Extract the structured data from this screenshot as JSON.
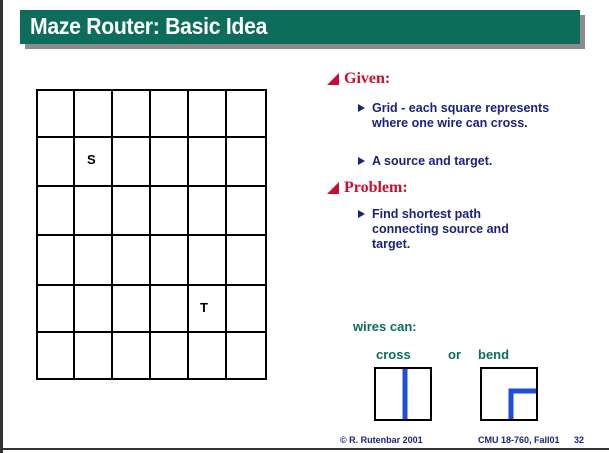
{
  "slide": {
    "title": "Maze Router: Basic Idea"
  },
  "grid": {
    "source_label": "S",
    "target_label": "T"
  },
  "content": {
    "given_heading": "Given:",
    "given_bullets": [
      "Grid - each square represents where one wire can cross.",
      "A source and target."
    ],
    "problem_heading": "Problem:",
    "problem_bullets": [
      "Find shortest path connecting source and target."
    ]
  },
  "wires": {
    "heading": "wires can:",
    "cross_label": "cross",
    "or_label": "or",
    "bend_label": "bend"
  },
  "footer": {
    "copyright": "© R. Rutenbar 2001",
    "course": "CMU 18-760, Fall01",
    "page_number": "32"
  },
  "colors": {
    "title_bar": "#0c6e5a",
    "heading_red": "#c8102e",
    "bullet_navy": "#1a237e",
    "wire_blue": "#1f4ed8"
  }
}
